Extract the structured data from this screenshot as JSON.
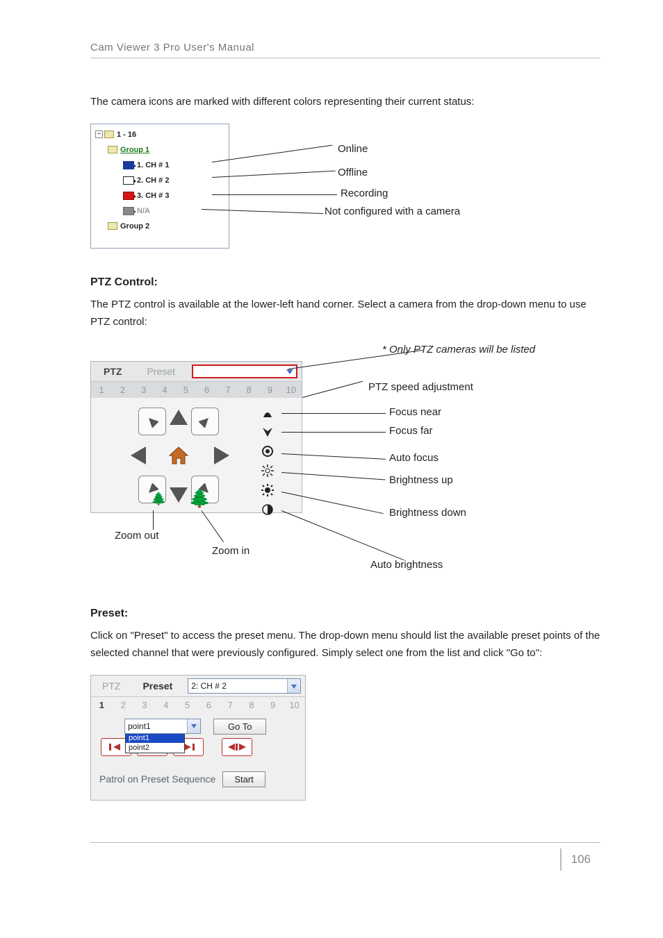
{
  "header": {
    "title": "Cam Viewer 3 Pro User's Manual"
  },
  "intro": "The camera icons are marked with different colors representing their current status:",
  "tree": {
    "root": "1 - 16",
    "group1": "Group 1",
    "ch1": "1. CH # 1",
    "ch2": "2. CH # 2",
    "ch3": "3. CH # 3",
    "na": "N/A",
    "group2": "Group 2"
  },
  "status": {
    "online": "Online",
    "offline": "Offline",
    "recording": "Recording",
    "notconfigured": "Not configured with a camera"
  },
  "ptz": {
    "heading": "PTZ Control:",
    "text": "The PTZ control is available at the lower-left hand corner. Select a camera from the drop-down menu to use PTZ control:",
    "note": "* Only PTZ cameras will be listed",
    "tab_ptz": "PTZ",
    "tab_preset": "Preset",
    "speed": [
      "1",
      "2",
      "3",
      "4",
      "5",
      "6",
      "7",
      "8",
      "9",
      "10"
    ],
    "labels": {
      "speed_adj": "PTZ speed adjustment",
      "focus_near": "Focus near",
      "focus_far": "Focus far",
      "auto_focus": "Auto focus",
      "bright_up": "Brightness up",
      "bright_down": "Brightness down",
      "auto_bright": "Auto brightness",
      "zoom_out": "Zoom out",
      "zoom_in": "Zoom in"
    }
  },
  "preset": {
    "heading": "Preset:",
    "text": "Click on \"Preset\" to access the preset menu. The drop-down menu should list the available preset points of the selected channel that were previously configured. Simply select one from the list and click \"Go to\":",
    "tab_ptz": "PTZ",
    "tab_preset": "Preset",
    "channel": "2: CH # 2",
    "speed": [
      "1",
      "2",
      "3",
      "4",
      "5",
      "6",
      "7",
      "8",
      "9",
      "10"
    ],
    "selected_point": "point1",
    "goto": "Go To",
    "options": [
      "point1",
      "point2"
    ],
    "patrol": "Patrol on Preset Sequence",
    "start": "Start"
  },
  "page_number": "106"
}
